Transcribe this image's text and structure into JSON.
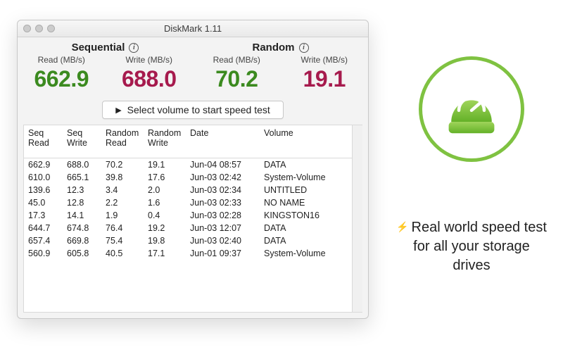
{
  "window": {
    "title": "DiskMark 1.11"
  },
  "metrics": {
    "sequential": {
      "heading": "Sequential",
      "read_label": "Read (MB/s)",
      "write_label": "Write (MB/s)",
      "read": "662.9",
      "write": "688.0"
    },
    "random": {
      "heading": "Random",
      "read_label": "Read (MB/s)",
      "write_label": "Write (MB/s)",
      "read": "70.2",
      "write": "19.1"
    }
  },
  "select_button": "Select volume to start speed test",
  "table": {
    "headers": {
      "seq_read": "Seq Read",
      "seq_write": "Seq Write",
      "rand_read": "Random Read",
      "rand_write": "Random Write",
      "date": "Date",
      "volume": "Volume"
    },
    "rows": [
      {
        "sr": "662.9",
        "sw": "688.0",
        "rr": "70.2",
        "rw": "19.1",
        "date": "Jun-04 08:57",
        "vol": "DATA"
      },
      {
        "sr": "610.0",
        "sw": "665.1",
        "rr": "39.8",
        "rw": "17.6",
        "date": "Jun-03 02:42",
        "vol": "System-Volume"
      },
      {
        "sr": "139.6",
        "sw": "12.3",
        "rr": "3.4",
        "rw": "2.0",
        "date": "Jun-03 02:34",
        "vol": "UNTITLED"
      },
      {
        "sr": "45.0",
        "sw": "12.8",
        "rr": "2.2",
        "rw": "1.6",
        "date": "Jun-03 02:33",
        "vol": "NO NAME"
      },
      {
        "sr": "17.3",
        "sw": "14.1",
        "rr": "1.9",
        "rw": "0.4",
        "date": "Jun-03 02:28",
        "vol": "KINGSTON16"
      },
      {
        "sr": "644.7",
        "sw": "674.8",
        "rr": "76.4",
        "rw": "19.2",
        "date": "Jun-03 12:07",
        "vol": "DATA"
      },
      {
        "sr": "657.4",
        "sw": "669.8",
        "rr": "75.4",
        "rw": "19.8",
        "date": "Jun-03 02:40",
        "vol": "DATA"
      },
      {
        "sr": "560.9",
        "sw": "605.8",
        "rr": "40.5",
        "rw": "17.1",
        "date": "Jun-01 09:37",
        "vol": "System-Volume"
      }
    ]
  },
  "tagline": "Real world speed test for all your storage drives",
  "icons": {
    "info": "i",
    "play": "▶",
    "bolt": "⚡"
  }
}
